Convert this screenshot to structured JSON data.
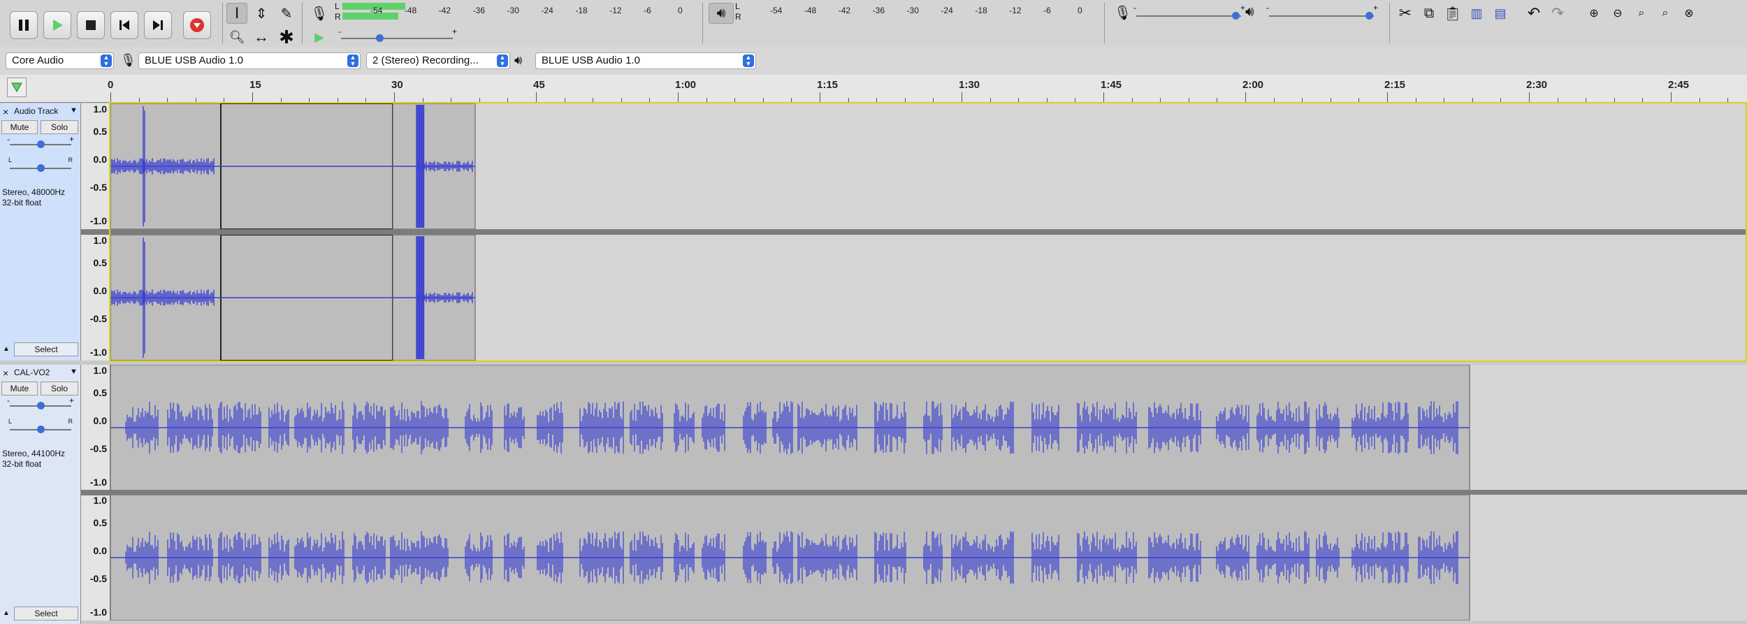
{
  "transport": {
    "pause": "pause-button",
    "play": "play-button",
    "stop": "stop-button",
    "skip_start": "skip-to-start",
    "skip_end": "skip-to-end",
    "record": "record-button"
  },
  "meters": {
    "record_scale": [
      "-54",
      "-48",
      "-42",
      "-36",
      "-30",
      "-24",
      "-18",
      "-12",
      "-6",
      "0"
    ],
    "play_scale": [
      "-54",
      "-48",
      "-42",
      "-36",
      "-30",
      "-24",
      "-18",
      "-12",
      "-6",
      "0"
    ],
    "channel_l": "L",
    "channel_r": "R",
    "record_level_l": 0.18,
    "record_level_r": 0.16
  },
  "sliders": {
    "minus": "-",
    "plus": "+",
    "record_volume": 0.97,
    "play_volume": 0.98,
    "playback_speed": 0.33
  },
  "devices": {
    "host": "Core Audio",
    "recording_device": "BLUE USB Audio 1.0",
    "channels": "2 (Stereo) Recording...",
    "playback_device": "BLUE USB Audio 1.0"
  },
  "ruler": {
    "labels": [
      "0",
      "15",
      "30",
      "45",
      "1:00",
      "1:15",
      "1:30",
      "1:45",
      "2:00",
      "2:15",
      "2:30",
      "2:45"
    ]
  },
  "vscale": [
    "1.0",
    "0.5",
    "0.0",
    "-0.5",
    "-1.0"
  ],
  "tracks": [
    {
      "name": "Audio Track",
      "mute": "Mute",
      "solo": "Solo",
      "pan_l": "L",
      "pan_r": "R",
      "rate": "Stereo, 48000Hz",
      "format": "32-bit float",
      "select": "Select",
      "close": "×"
    },
    {
      "name": "CAL-VO2",
      "mute": "Mute",
      "solo": "Solo",
      "pan_l": "L",
      "pan_r": "R",
      "rate": "Stereo, 44100Hz",
      "format": "32-bit float",
      "select": "Select",
      "close": "×"
    }
  ],
  "colors": {
    "waveform": "#3a3fd0",
    "selection": "#d6d41c",
    "record": "#d33",
    "meter": "#5fd16a"
  }
}
